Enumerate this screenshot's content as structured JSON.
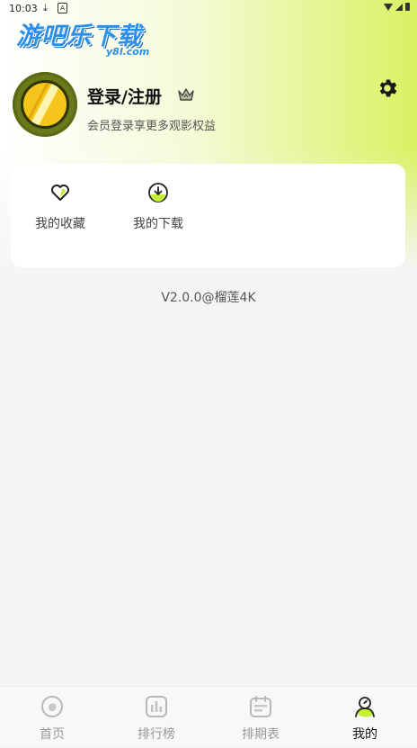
{
  "status_bar": {
    "time": "10:03"
  },
  "logo": {
    "main": "游吧乐下载",
    "sub": "y8l.com"
  },
  "profile": {
    "title": "登录/注册",
    "subtitle": "会员登录享更多观影权益"
  },
  "shortcuts": [
    {
      "label": "我的收藏",
      "icon": "heart-icon"
    },
    {
      "label": "我的下载",
      "icon": "download-icon"
    }
  ],
  "version": "V2.0.0@榴莲4K",
  "bottom_nav": [
    {
      "label": "首页",
      "icon": "home-icon",
      "active": false
    },
    {
      "label": "排行榜",
      "icon": "ranking-icon",
      "active": false
    },
    {
      "label": "排期表",
      "icon": "schedule-icon",
      "active": false
    },
    {
      "label": "我的",
      "icon": "profile-icon",
      "active": true
    }
  ],
  "colors": {
    "accent": "#d9f263",
    "icon_fill": "#c6ee32",
    "logo_blue": "#2b8fe8"
  }
}
